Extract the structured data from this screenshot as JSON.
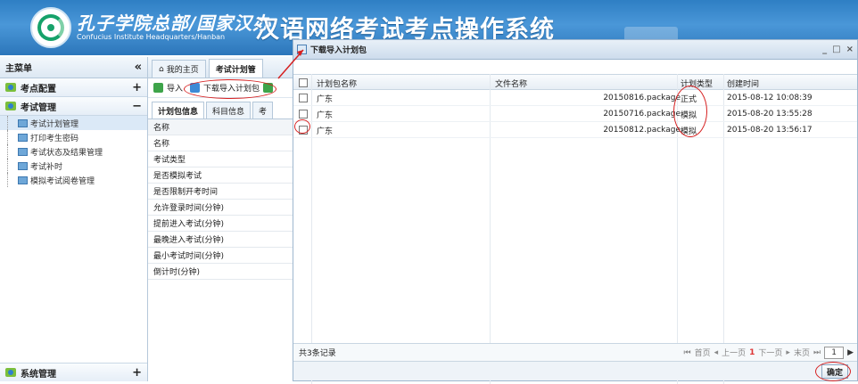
{
  "header": {
    "org_cn": "孔子学院总部/国家汉办",
    "org_en": "Confucius Institute Headquarters/Hanban",
    "system_title": "汉语网络考试考点操作系统"
  },
  "sidebar": {
    "title": "主菜单",
    "collapse": "«",
    "cat1": {
      "label": "考点配置",
      "toggle": "+"
    },
    "cat2": {
      "label": "考试管理",
      "toggle": "−"
    },
    "items": [
      {
        "label": "考试计划管理"
      },
      {
        "label": "打印考生密码"
      },
      {
        "label": "考试状态及结果管理"
      },
      {
        "label": "考试补时"
      },
      {
        "label": "模拟考试阅卷管理"
      }
    ],
    "cat3": {
      "label": "系统管理",
      "toggle": "+"
    }
  },
  "panel": {
    "tab_home": "我的主页",
    "tab_plan": "考试计划管",
    "toolbar": {
      "import": "导入",
      "download": "下载导入计划包"
    },
    "subtabs": [
      "计划包信息",
      "科目信息",
      "考"
    ],
    "fields": [
      "名称",
      "名称",
      "考试类型",
      "是否模拟考试",
      "是否限制开考时间",
      "允许登录时间(分钟)",
      "提前进入考试(分钟)",
      "最晚进入考试(分钟)",
      "最小考试时间(分钟)",
      "倒计时(分钟)"
    ]
  },
  "dialog": {
    "title": "下载导入计划包",
    "controls": [
      "_",
      "□",
      "×"
    ],
    "columns": {
      "name": "计划包名称",
      "file": "文件名称",
      "type": "计划类型",
      "time": "创建时间"
    },
    "rows": [
      {
        "name": "广东",
        "file": "20150816.package",
        "type": "正式",
        "time": "2015-08-12 10:08:39"
      },
      {
        "name": "广东",
        "file": "20150716.package",
        "type": "模拟",
        "time": "2015-08-20 13:55:28"
      },
      {
        "name": "广东",
        "file": "20150812.package",
        "type": "模拟",
        "time": "2015-08-20 13:56:17"
      }
    ],
    "footer": {
      "count": "共3条记录",
      "first": "首页",
      "prev": "上一页",
      "page": "1",
      "next": "下一页",
      "last": "末页",
      "page_input": "1"
    },
    "ok": "确定"
  }
}
